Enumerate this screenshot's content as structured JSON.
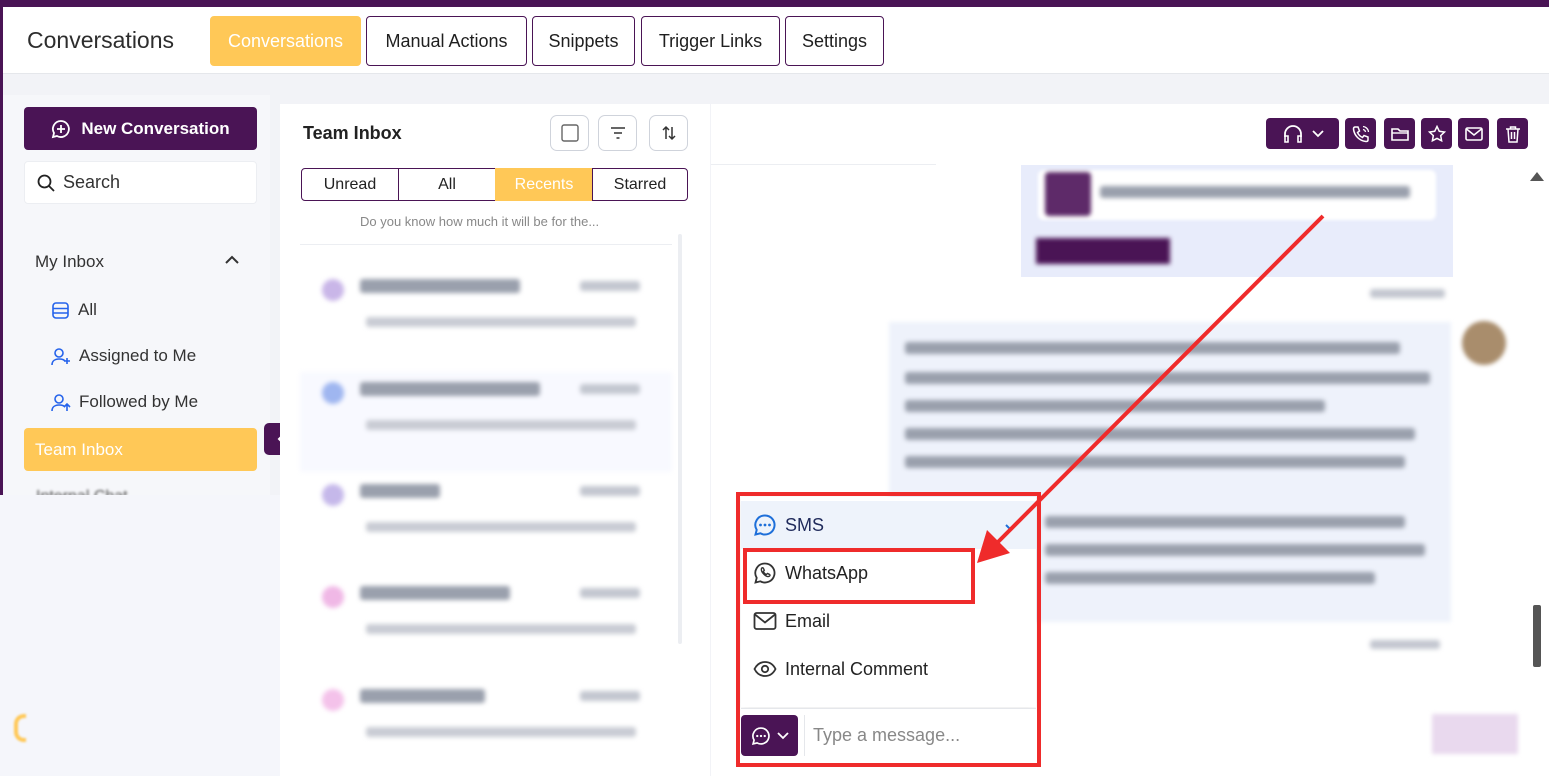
{
  "header": {
    "title": "Conversations",
    "tabs": [
      {
        "label": "Conversations",
        "active": true
      },
      {
        "label": "Manual Actions",
        "active": false
      },
      {
        "label": "Snippets",
        "active": false
      },
      {
        "label": "Trigger Links",
        "active": false
      },
      {
        "label": "Settings",
        "active": false
      }
    ]
  },
  "sidebar": {
    "new_conversation": "New Conversation",
    "search_label": "Search",
    "my_inbox": "My Inbox",
    "items": [
      {
        "label": "All",
        "icon": "list-icon"
      },
      {
        "label": "Assigned to Me",
        "icon": "user-plus-icon"
      },
      {
        "label": "Followed by Me",
        "icon": "user-follow-icon"
      }
    ],
    "team_inbox": "Team Inbox",
    "internal_chat": "Internal Chat"
  },
  "list": {
    "title": "Team Inbox",
    "filters": [
      {
        "label": "Unread",
        "active": false
      },
      {
        "label": "All",
        "active": false
      },
      {
        "label": "Recents",
        "active": true
      },
      {
        "label": "Starred",
        "active": false
      }
    ],
    "top_snippet": "Do you know how much it will be for the..."
  },
  "composer": {
    "channels": [
      {
        "label": "SMS",
        "icon": "chat-bubble-icon",
        "selected": true
      },
      {
        "label": "WhatsApp",
        "icon": "whatsapp-icon",
        "selected": false
      },
      {
        "label": "Email",
        "icon": "mail-icon",
        "selected": false
      },
      {
        "label": "Internal Comment",
        "icon": "eye-icon",
        "selected": false
      }
    ],
    "placeholder": "Type a message..."
  },
  "colors": {
    "brand": "#4a1455",
    "accent": "#ffc857",
    "annotation": "#ef2b2b",
    "sms_blue": "#1e6fd9"
  }
}
